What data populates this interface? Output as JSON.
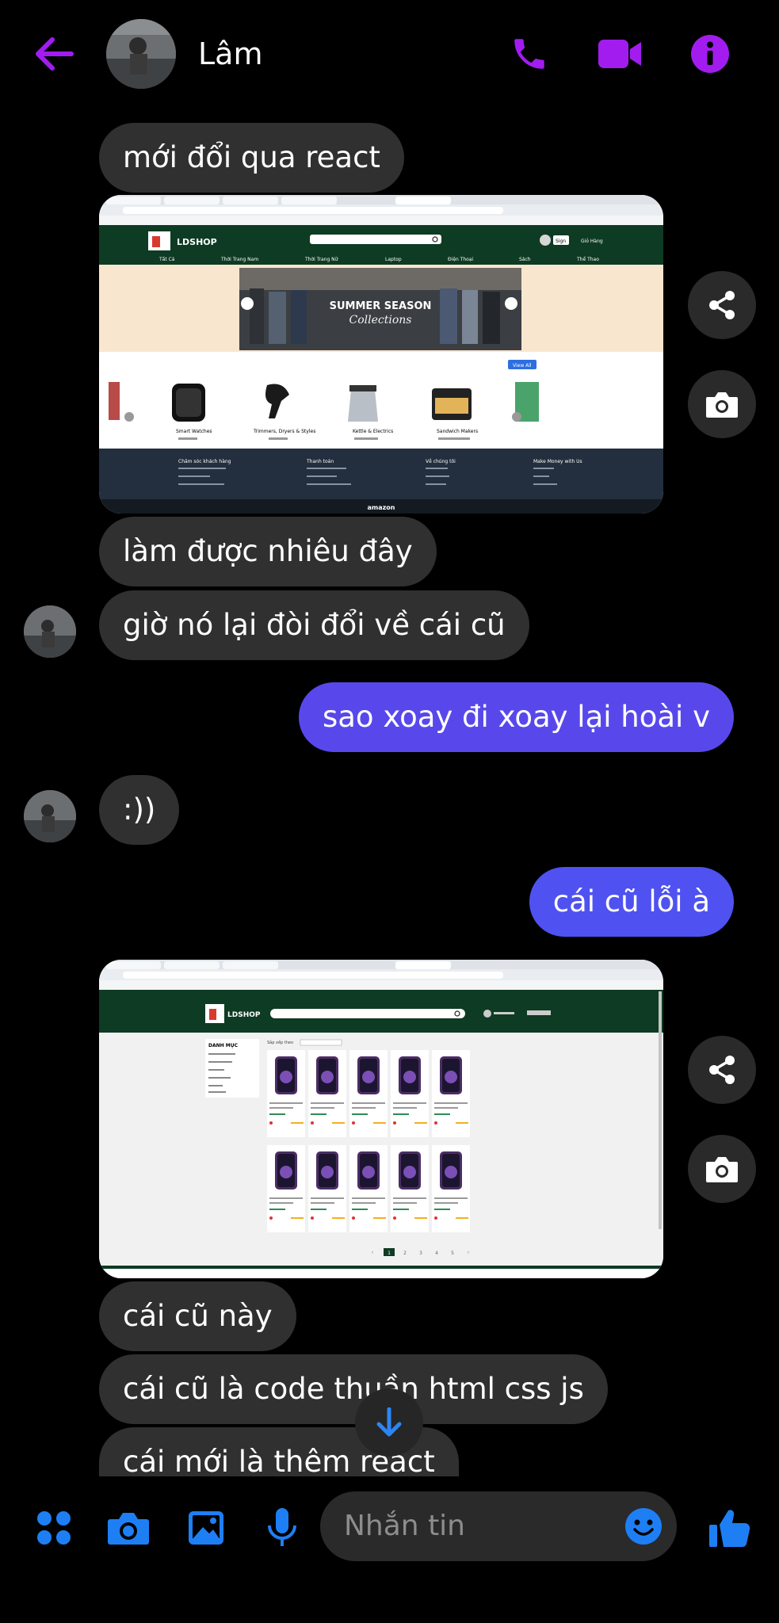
{
  "header": {
    "contact_name": "Lâm",
    "back_icon": "arrow-left-icon",
    "call_icon": "phone-icon",
    "video_icon": "video-camera-icon",
    "info_icon": "info-icon",
    "accent_color": "#a21cf0"
  },
  "messages": [
    {
      "sender": "them",
      "text": "mới đổi qua react"
    },
    {
      "sender": "them",
      "type": "image",
      "label": "screenshot-react-shop"
    },
    {
      "sender": "them",
      "text": "làm được nhiêu đây"
    },
    {
      "sender": "them",
      "text": "giờ nó lại đòi đổi về cái cũ"
    },
    {
      "sender": "me",
      "text": "sao xoay đi xoay lại hoài v"
    },
    {
      "sender": "them",
      "text": ":))"
    },
    {
      "sender": "me",
      "text": "cái cũ lỗi à"
    },
    {
      "sender": "them",
      "type": "image",
      "label": "screenshot-old-shop"
    },
    {
      "sender": "them",
      "text": "cái cũ này"
    },
    {
      "sender": "them",
      "text": "cái cũ là code thuần html css js"
    },
    {
      "sender": "them",
      "text": "cái mới là thêm react"
    }
  ],
  "shot1": {
    "logo": "LDSHOP",
    "sign": "Sign",
    "cart": "Giỏ Hàng",
    "nav": [
      "Tất Cả",
      "Thời Trang Nam",
      "Thời Trang Nữ",
      "Laptop",
      "Điện Thoại",
      "Sách",
      "Thể Thao"
    ],
    "banner_line1": "SUMMER SEASON",
    "banner_line2": "Collections",
    "view_all": "View All",
    "products": [
      "Smart Watches",
      "Trimmers, Dryers & Styles",
      "Kettle & Electrics",
      "Sandwich Makers"
    ],
    "footer_cols": [
      "Chăm sóc khách hàng",
      "Thanh toán",
      "Về chúng tôi",
      "Make Money with Us"
    ],
    "footer_brand": "amazon"
  },
  "shot2": {
    "logo": "LDSHOP",
    "sidebar_title": "DANH MỤC",
    "sort_label": "Sắp xếp theo",
    "pages": [
      "1",
      "2",
      "3",
      "4",
      "5"
    ]
  },
  "composer": {
    "placeholder": "Nhắn tin",
    "apps_icon": "grid-dots-icon",
    "camera_icon": "camera-icon",
    "gallery_icon": "image-icon",
    "mic_icon": "microphone-icon",
    "emoji_icon": "emoji-icon",
    "like_icon": "thumbs-up-icon",
    "accent_color": "#1e7ff5"
  },
  "actions": {
    "share_icon": "share-icon",
    "camera_icon": "camera-icon",
    "scroll_down_icon": "arrow-down-icon"
  }
}
